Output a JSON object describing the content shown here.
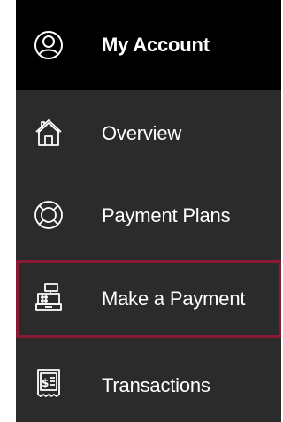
{
  "header": {
    "title": "My Account",
    "icon": "user-circle-icon"
  },
  "menu": {
    "items": [
      {
        "label": "Overview",
        "icon": "home-icon"
      },
      {
        "label": "Payment Plans",
        "icon": "lifebuoy-icon"
      },
      {
        "label": "Make a Payment",
        "icon": "cash-register-icon",
        "active": true
      },
      {
        "label": "Transactions",
        "icon": "receipt-icon"
      }
    ]
  },
  "colors": {
    "header_bg": "#000000",
    "menu_bg": "#2b2b2b",
    "text": "#ffffff",
    "active_border": "#8a1a34"
  }
}
